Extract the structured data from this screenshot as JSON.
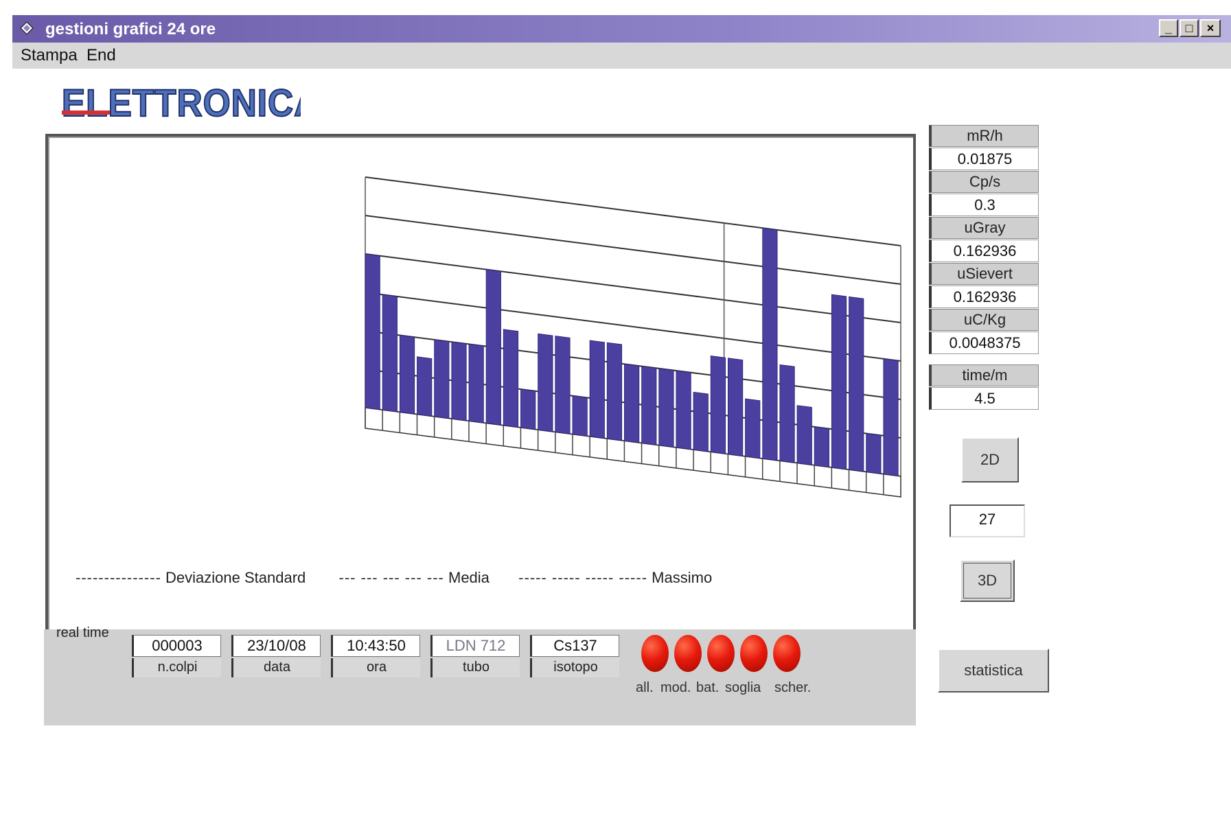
{
  "window": {
    "title": "gestioni grafici 24 ore",
    "minimize": "_",
    "maximize": "□",
    "close": "×"
  },
  "menu": {
    "items": [
      "Stampa",
      "End"
    ]
  },
  "logo": {
    "text": "ELETTRONICA"
  },
  "legend": {
    "std_label": "Deviazione Standard",
    "mean_label": "Media",
    "max_label": "Massimo",
    "std_dashes": "---------------",
    "mean_dashes": "--- --- --- --- ---",
    "max_dashes": "----- ----- ----- -----"
  },
  "readings": {
    "mrh_label": "mR/h",
    "mrh_value": "0.01875",
    "cps_label": "Cp/s",
    "cps_value": "0.3",
    "ugray_label": "uGray",
    "ugray_value": "0.162936",
    "usievert_label": "uSievert",
    "usievert_value": "0.162936",
    "uckg_label": "uC/Kg",
    "uckg_value": "0.0048375",
    "time_label": "time/m",
    "time_value": "4.5"
  },
  "controls": {
    "btn_2d": "2D",
    "count_value": "27",
    "btn_3d": "3D",
    "statistics": "statistica"
  },
  "status": {
    "realtime_label": "real time",
    "fields": [
      {
        "value": "000003",
        "label": "n.colpi"
      },
      {
        "value": "23/10/08",
        "label": "data"
      },
      {
        "value": "10:43:50",
        "label": "ora"
      },
      {
        "value": "LDN 712",
        "label": "tubo"
      },
      {
        "value": "Cs137",
        "label": "isotopo"
      }
    ],
    "leds": [
      "all.",
      "mod.",
      "bat.",
      "soglia",
      "scher."
    ],
    "led_color": "#e61a0c"
  },
  "chart_data": {
    "type": "bar",
    "ylim": [
      0,
      6
    ],
    "right_ticks": [
      "0",
      "1",
      "2",
      "3",
      "4",
      "5",
      "6"
    ],
    "values": [
      4,
      3,
      2,
      1.5,
      2,
      2,
      2,
      4,
      2.5,
      1,
      2.5,
      2.5,
      1,
      2.5,
      2.5,
      2,
      2,
      2,
      2,
      1.5,
      2.5,
      2.5,
      1.5,
      6,
      2.5,
      1.5,
      1,
      4.5,
      4.5,
      1,
      3
    ]
  }
}
